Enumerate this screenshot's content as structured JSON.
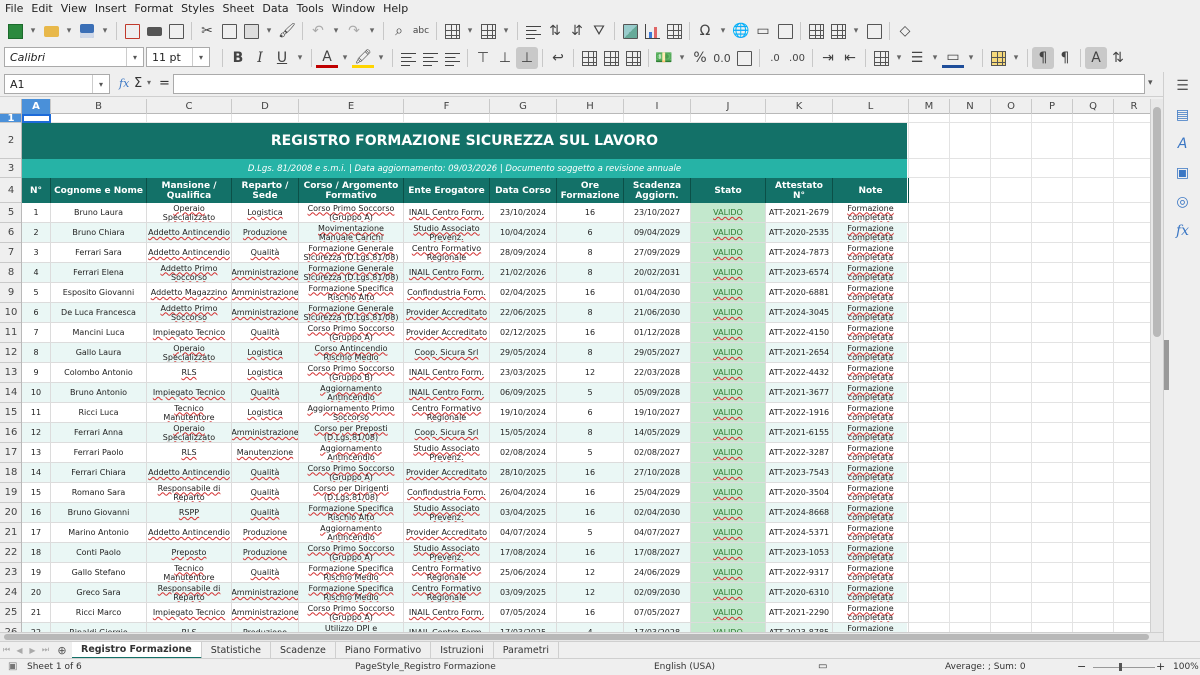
{
  "menu": [
    "File",
    "Edit",
    "View",
    "Insert",
    "Format",
    "Styles",
    "Sheet",
    "Data",
    "Tools",
    "Window",
    "Help"
  ],
  "toolbar1_icons": [
    "new-icon",
    "open-icon",
    "save-icon",
    "export-pdf-icon",
    "print-icon",
    "print-preview-icon",
    "cut-icon",
    "copy-icon",
    "paste-icon",
    "clone-formatting-icon",
    "undo-icon",
    "redo-icon",
    "find-replace-icon",
    "spelling-icon",
    "row-icon",
    "column-icon",
    "sort-icon",
    "sort-ascending-icon",
    "sort-descending-icon",
    "autofilter-icon",
    "image-icon",
    "chart-icon",
    "pivot-table-icon",
    "special-character-icon",
    "hyperlink-icon",
    "comment-icon",
    "header-footer-icon",
    "define-print-area-icon",
    "freeze-rows-icon",
    "split-window-icon",
    "show-draw-functions-icon"
  ],
  "toolbar2": {
    "font_name": "Calibri",
    "font_size": "11 pt",
    "icons": [
      "bold-icon",
      "italic-icon",
      "underline-icon",
      "font-color-icon",
      "highlight-icon",
      "align-left-icon",
      "align-center-icon",
      "align-right-icon",
      "align-top-icon",
      "center-vertically-icon",
      "align-bottom-icon",
      "wrap-text-icon",
      "merge-center-icon",
      "merge-cells-icon",
      "unmerge-cells-icon",
      "currency-icon",
      "percent-icon",
      "number-format-icon",
      "date-format-icon",
      "add-decimal-icon",
      "delete-decimal-icon",
      "increase-indent-icon",
      "decrease-indent-icon",
      "borders-icon",
      "border-style-icon",
      "border-color-icon",
      "conditional-format-icon",
      "left-to-right-icon",
      "right-to-left-icon",
      "text-direction-icon",
      "vertical-text-icon"
    ],
    "bold": "B",
    "italic": "I",
    "underline": "U",
    "font_color": "A"
  },
  "formula_bar": {
    "name_box": "A1",
    "fx": "fx",
    "sum": "Σ",
    "equals": "=",
    "content": ""
  },
  "sidebar_icons": [
    "properties-icon",
    "styles-icon",
    "gallery-icon",
    "navigator-icon",
    "functions-icon"
  ],
  "colors": {
    "teal_dark": "#137168",
    "teal_light": "#26b3a6",
    "status_fill": "#c3e8cd",
    "status_text": "#2e7d32",
    "selection": "#4a90d9"
  },
  "columns": [
    "A",
    "B",
    "C",
    "D",
    "E",
    "F",
    "G",
    "H",
    "I",
    "J",
    "K",
    "L",
    "M",
    "N",
    "O",
    "P",
    "Q",
    "R"
  ],
  "rows": [
    "1",
    "2",
    "3",
    "4",
    "5",
    "6",
    "7",
    "8",
    "9",
    "10",
    "11",
    "12",
    "13",
    "14",
    "15",
    "16",
    "17",
    "18",
    "19",
    "20",
    "21",
    "22",
    "23",
    "24",
    "25",
    "26"
  ],
  "sheet": {
    "title": "REGISTRO FORMAZIONE SICUREZZA SUL LAVORO",
    "subtitle": "D.Lgs. 81/2008 e s.m.i.  |  Data aggiornamento: 09/03/2026  |  Documento soggetto a revisione annuale",
    "headers": [
      "N°",
      "Cognome e Nome",
      "Mansione / Qualifica",
      "Reparto / Sede",
      "Corso / Argomento Formativo",
      "Ente Erogatore",
      "Data Corso",
      "Ore Formazione",
      "Scadenza Aggiorn.",
      "Stato",
      "Attestato N°",
      "Note"
    ],
    "data_rows": [
      [
        "1",
        "Bruno Laura",
        "Operaio Specializzato",
        "Logistica",
        "Corso Primo Soccorso (Gruppo A)",
        "INAIL Centro Form.",
        "23/10/2024",
        "16",
        "23/10/2027",
        "VALIDO",
        "ATT-2021-2679",
        "Formazione completata"
      ],
      [
        "2",
        "Bruno Chiara",
        "Addetto Antincendio",
        "Produzione",
        "Movimentazione Manuale Carichi",
        "Studio Associato Prevenz.",
        "10/04/2024",
        "6",
        "09/04/2029",
        "VALIDO",
        "ATT-2020-2535",
        "Formazione completata"
      ],
      [
        "3",
        "Ferrari Sara",
        "Addetto Antincendio",
        "Qualità",
        "Formazione Generale Sicurezza (D.Lgs.81/08)",
        "Centro Formativo Regionale",
        "28/09/2024",
        "8",
        "27/09/2029",
        "VALIDO",
        "ATT-2024-7873",
        "Formazione completata"
      ],
      [
        "4",
        "Ferrari Elena",
        "Addetto Primo Soccorso",
        "Amministrazione",
        "Formazione Generale Sicurezza (D.Lgs.81/08)",
        "INAIL Centro Form.",
        "21/02/2026",
        "8",
        "20/02/2031",
        "VALIDO",
        "ATT-2023-6574",
        "Formazione completata"
      ],
      [
        "5",
        "Esposito Giovanni",
        "Addetto Magazzino",
        "Amministrazione",
        "Formazione Specifica Rischio Alto",
        "Confindustria Form.",
        "02/04/2025",
        "16",
        "01/04/2030",
        "VALIDO",
        "ATT-2020-6881",
        "Formazione completata"
      ],
      [
        "6",
        "De Luca Francesca",
        "Addetto Primo Soccorso",
        "Amministrazione",
        "Formazione Generale Sicurezza (D.Lgs.81/08)",
        "Provider Accreditato",
        "22/06/2025",
        "8",
        "21/06/2030",
        "VALIDO",
        "ATT-2024-3045",
        "Formazione completata"
      ],
      [
        "7",
        "Mancini Luca",
        "Impiegato Tecnico",
        "Qualità",
        "Corso Primo Soccorso (Gruppo A)",
        "Provider Accreditato",
        "02/12/2025",
        "16",
        "01/12/2028",
        "VALIDO",
        "ATT-2022-4150",
        "Formazione completata"
      ],
      [
        "8",
        "Gallo Laura",
        "Operaio Specializzato",
        "Logistica",
        "Corso Antincendio Rischio Medio",
        "Coop. Sicura Srl",
        "29/05/2024",
        "8",
        "29/05/2027",
        "VALIDO",
        "ATT-2021-2654",
        "Formazione completata"
      ],
      [
        "9",
        "Colombo Antonio",
        "RLS",
        "Logistica",
        "Corso Primo Soccorso (Gruppo B)",
        "INAIL Centro Form.",
        "23/03/2025",
        "12",
        "22/03/2028",
        "VALIDO",
        "ATT-2022-4432",
        "Formazione completata"
      ],
      [
        "10",
        "Bruno Antonio",
        "Impiegato Tecnico",
        "Qualità",
        "Aggiornamento Antincendio",
        "INAIL Centro Form.",
        "06/09/2025",
        "5",
        "05/09/2028",
        "VALIDO",
        "ATT-2021-3677",
        "Formazione completata"
      ],
      [
        "11",
        "Ricci Luca",
        "Tecnico Manutentore",
        "Logistica",
        "Aggiornamento Primo Soccorso",
        "Centro Formativo Regionale",
        "19/10/2024",
        "6",
        "19/10/2027",
        "VALIDO",
        "ATT-2022-1916",
        "Formazione completata"
      ],
      [
        "12",
        "Ferrari Anna",
        "Operaio Specializzato",
        "Amministrazione",
        "Corso per Preposti (D.Lgs.81/08)",
        "Coop. Sicura Srl",
        "15/05/2024",
        "8",
        "14/05/2029",
        "VALIDO",
        "ATT-2021-6155",
        "Formazione completata"
      ],
      [
        "13",
        "Ferrari Paolo",
        "RLS",
        "Manutenzione",
        "Aggiornamento Antincendio",
        "Studio Associato Prevenz.",
        "02/08/2024",
        "5",
        "02/08/2027",
        "VALIDO",
        "ATT-2022-3287",
        "Formazione completata"
      ],
      [
        "14",
        "Ferrari Chiara",
        "Addetto Antincendio",
        "Qualità",
        "Corso Primo Soccorso (Gruppo A)",
        "Provider Accreditato",
        "28/10/2025",
        "16",
        "27/10/2028",
        "VALIDO",
        "ATT-2023-7543",
        "Formazione completata"
      ],
      [
        "15",
        "Romano Sara",
        "Responsabile di Reparto",
        "Qualità",
        "Corso per Dirigenti (D.Lgs.81/08)",
        "Confindustria Form.",
        "26/04/2024",
        "16",
        "25/04/2029",
        "VALIDO",
        "ATT-2020-3504",
        "Formazione completata"
      ],
      [
        "16",
        "Bruno Giovanni",
        "RSPP",
        "Qualità",
        "Formazione Specifica Rischio Alto",
        "Studio Associato Prevenz.",
        "03/04/2025",
        "16",
        "02/04/2030",
        "VALIDO",
        "ATT-2024-8668",
        "Formazione completata"
      ],
      [
        "17",
        "Marino Antonio",
        "Addetto Antincendio",
        "Produzione",
        "Aggiornamento Antincendio",
        "Provider Accreditato",
        "04/07/2024",
        "5",
        "04/07/2027",
        "VALIDO",
        "ATT-2024-5371",
        "Formazione completata"
      ],
      [
        "18",
        "Conti Paolo",
        "Preposto",
        "Produzione",
        "Corso Primo Soccorso (Gruppo A)",
        "Studio Associato Prevenz.",
        "17/08/2024",
        "16",
        "17/08/2027",
        "VALIDO",
        "ATT-2023-1053",
        "Formazione completata"
      ],
      [
        "19",
        "Gallo Stefano",
        "Tecnico Manutentore",
        "Qualità",
        "Formazione Specifica Rischio Medio",
        "Centro Formativo Regionale",
        "25/06/2024",
        "12",
        "24/06/2029",
        "VALIDO",
        "ATT-2022-9317",
        "Formazione completata"
      ],
      [
        "20",
        "Greco Sara",
        "Responsabile di Reparto",
        "Amministrazione",
        "Formazione Specifica Rischio Medio",
        "Centro Formativo Regionale",
        "03/09/2025",
        "12",
        "02/09/2030",
        "VALIDO",
        "ATT-2020-6310",
        "Formazione completata"
      ],
      [
        "21",
        "Ricci Marco",
        "Impiegato Tecnico",
        "Amministrazione",
        "Corso Primo Soccorso (Gruppo A)",
        "INAIL Centro Form.",
        "07/05/2024",
        "16",
        "07/05/2027",
        "VALIDO",
        "ATT-2021-2290",
        "Formazione completata"
      ],
      [
        "22",
        "Rinaldi Giorgio",
        "RLS",
        "Produzione",
        "Utilizzo DPI e Attrezzature",
        "INAIL Centro Form.",
        "17/03/2025",
        "4",
        "17/03/2028",
        "VALIDO",
        "ATT-2023-8785",
        "Formazione completata"
      ]
    ]
  },
  "sheet_tabs": [
    "Registro Formazione",
    "Statistiche",
    "Scadenze",
    "Piano Formativo",
    "Istruzioni",
    "Parametri"
  ],
  "active_tab": 0,
  "status_bar": {
    "sheet": "Sheet 1 of 6",
    "page_style": "PageStyle_Registro Formazione",
    "language": "English (USA)",
    "sum": "Average: ; Sum: 0",
    "zoom": "100%"
  }
}
